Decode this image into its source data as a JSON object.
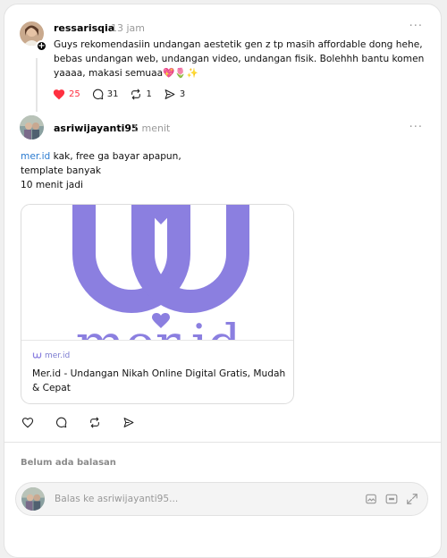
{
  "post1": {
    "username": "ressarisqia",
    "time": "13 jam",
    "text": "Guys rekomendasiin undangan aestetik gen z tp masih affordable dong hehe, bebas undangan web, undangan video, undangan fisik. Bolehhh bantu komen yaaaa, makasi semuaa💖🌷✨",
    "likes": "25",
    "replies": "31",
    "reposts": "1",
    "shares": "3",
    "more": "···",
    "plus": "+"
  },
  "post2": {
    "username": "asriwijayanti95",
    "time": "1 menit",
    "link_text": "mer.id",
    "text_line1": " kak, free ga bayar apapun,",
    "text_line2": "template banyak",
    "text_line3": "10 menit jadi",
    "more": "···"
  },
  "link_card": {
    "domain": "mer.id",
    "title": "Mer.id - Undangan Nikah Online Digital Gratis, Mudah & Cepat",
    "logo_text": "mer.id"
  },
  "replies_section": {
    "empty_text": "Belum ada balasan",
    "reply_placeholder": "Balas ke asriwijayanti95..."
  },
  "colors": {
    "like_red": "#ff3040",
    "brand_purple": "#8b7fe0",
    "link_blue": "#2b7bd0"
  }
}
